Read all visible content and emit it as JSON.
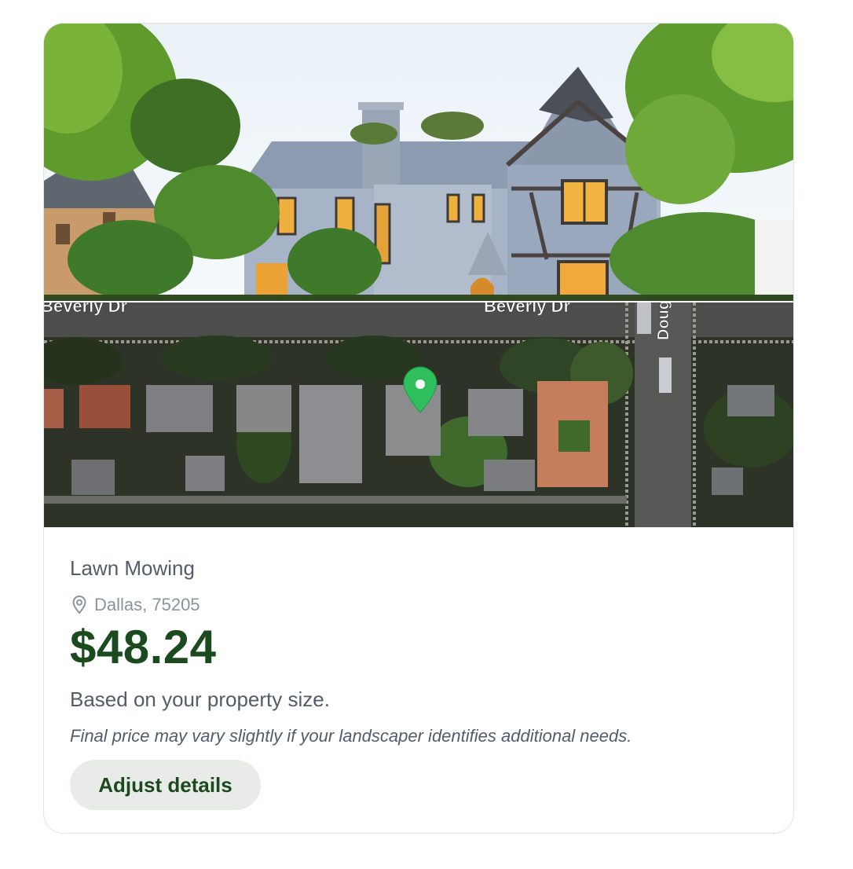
{
  "listing": {
    "service_name": "Lawn Mowing",
    "location": "Dallas, 75205",
    "location_icon": "map-pin-outline-icon",
    "price": "$48.24",
    "basis_text": "Based on your property size.",
    "disclaimer": "Final price may vary slightly if your landscaper identifies additional needs.",
    "adjust_button_label": "Adjust details"
  },
  "map": {
    "street_labels": [
      "Beverly Dr",
      "Beverly Dr",
      "Doug"
    ],
    "marker_icon": "green-map-marker-icon"
  },
  "colors": {
    "price": "#1b4a1f",
    "button_bg": "#e9ebe8",
    "marker": "#2fbf5d",
    "body_text": "#525c6b",
    "muted_text": "#8b939e"
  }
}
